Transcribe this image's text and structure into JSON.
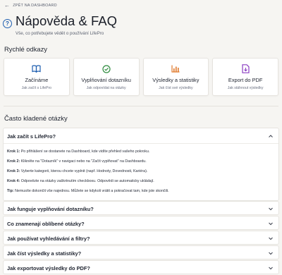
{
  "nav": {
    "back_label": "ZPĚT NA DASHBOARD"
  },
  "header": {
    "title": "Nápověda & FAQ",
    "subtitle": "Vše, co potřebujete vědět o používání LifePro"
  },
  "quick_links": {
    "heading": "Rychlé odkazy",
    "items": [
      {
        "title": "Začínáme",
        "subtitle": "Jak začít s LifePro",
        "icon": "book-icon",
        "color": "#1f5fb0"
      },
      {
        "title": "Vyplňování dotazníku",
        "subtitle": "Jak odpovídat na otázky",
        "icon": "check-circle-icon",
        "color": "#2e8b3e"
      },
      {
        "title": "Výsledky a statistiky",
        "subtitle": "Jak číst své výsledky",
        "icon": "bar-chart-icon",
        "color": "#e0792b"
      },
      {
        "title": "Export do PDF",
        "subtitle": "Jak stáhnout výsledky",
        "icon": "pdf-file-icon",
        "color": "#8a3cc2"
      }
    ]
  },
  "faq": {
    "heading": "Často kladené otázky",
    "open_item": {
      "question": "Jak začít s LifePro?",
      "answers": [
        {
          "label": "Krok 1:",
          "text": " Po přihlášení se dostanete na Dashboard, kde vidíte přehled vašeho pokroku."
        },
        {
          "label": "Krok 2:",
          "text": " Klikněte na \"Dotazník\" v navigaci nebo na \"Začít vyplňovat\" na Dashboardu."
        },
        {
          "label": "Krok 3:",
          "text": " Vyberte kategorii, kterou chcete vyplnit (např. Hodnoty, Dovednosti, Kariéra)."
        },
        {
          "label": "Krok 4:",
          "text": " Odpovězte na otázky zaškrtnutím checkboxu. Odpovědi se automaticky ukládají."
        },
        {
          "label": "Tip:",
          "text": " Nemusíte dokončit vše najednou. Můžete se kdykoli vrátit a pokračovat tam, kde jste skončili."
        }
      ]
    },
    "items": [
      {
        "question": "Jak funguje vyplňování dotazníku?"
      },
      {
        "question": "Co znamenají oblíbené otázky?"
      },
      {
        "question": "Jak používat vyhledávání a filtry?"
      },
      {
        "question": "Jak číst výsledky a statistiky?"
      },
      {
        "question": "Jak exportovat výsledky do PDF?"
      }
    ]
  }
}
